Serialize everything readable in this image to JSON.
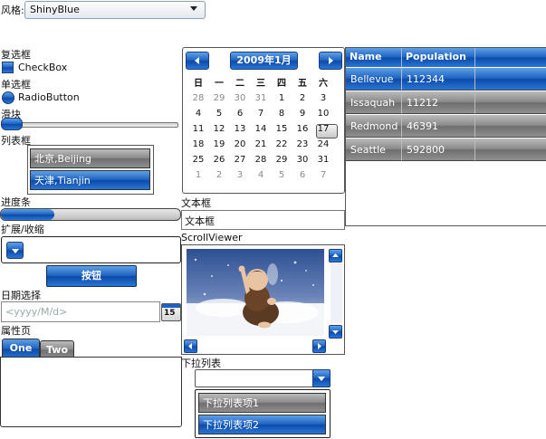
{
  "style": {
    "label": "风格:",
    "value": "ShinyBlue"
  },
  "labels": {
    "checkbox": "复选框",
    "radio": "单选框",
    "slider": "滑块",
    "listbox": "列表框",
    "progress": "进度条",
    "expander": "扩展/收缩",
    "datepicker": "日期选择",
    "tabs": "属性页",
    "textbox": "文本框",
    "scrollviewer": "ScrollViewer",
    "dropdown": "下拉列表"
  },
  "checkbox": {
    "text": "CheckBox",
    "checked": true
  },
  "radio": {
    "text": "RadioButton",
    "selected": true
  },
  "slider": {
    "value": 0
  },
  "listbox": {
    "items": [
      "北京,Beijing",
      "天津,Tianjin"
    ],
    "selected_index": 1
  },
  "progress": {
    "value": 0.3
  },
  "button": {
    "text": "按钮"
  },
  "datepicker": {
    "placeholder": "<yyyy/M/d>",
    "button_text": "15"
  },
  "tabs": {
    "items": [
      "One",
      "Two"
    ],
    "selected_index": 0
  },
  "calendar": {
    "title": "2009年1月",
    "weekdays": [
      "日",
      "一",
      "二",
      "三",
      "四",
      "五",
      "六"
    ],
    "weeks": [
      [
        "28",
        "29",
        "30",
        "31",
        "1",
        "2",
        "3"
      ],
      [
        "4",
        "5",
        "6",
        "7",
        "8",
        "9",
        "10"
      ],
      [
        "11",
        "12",
        "13",
        "14",
        "15",
        "16",
        "17"
      ],
      [
        "18",
        "19",
        "20",
        "21",
        "22",
        "23",
        "24"
      ],
      [
        "25",
        "26",
        "27",
        "28",
        "29",
        "30",
        "31"
      ],
      [
        "1",
        "2",
        "3",
        "4",
        "5",
        "6",
        "7"
      ]
    ],
    "today": "17"
  },
  "grid": {
    "columns": [
      "Name",
      "Population"
    ],
    "rows": [
      [
        "Bellevue",
        "112344"
      ],
      [
        "Issaquah",
        "11212"
      ],
      [
        "Redmond",
        "46391"
      ],
      [
        "Seattle",
        "592800"
      ]
    ],
    "selected_index": 0
  },
  "textbox": {
    "value": "文本框"
  },
  "dropdown": {
    "items": [
      "下拉列表项1",
      "下拉列表项2"
    ],
    "selected_index": 1
  },
  "colors": {
    "accent": "#1f63c2",
    "selected_dark": "#0c4aa8",
    "item_grey": "#8a8a8a"
  }
}
